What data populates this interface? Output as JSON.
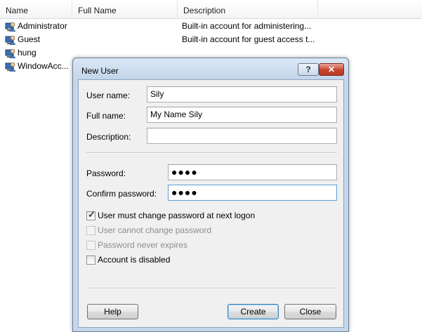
{
  "listview": {
    "columns": {
      "name": "Name",
      "full_name": "Full Name",
      "description": "Description"
    },
    "rows": [
      {
        "name": "Administrator",
        "full_name": "",
        "description": "Built-in account for administering..."
      },
      {
        "name": "Guest",
        "full_name": "",
        "description": "Built-in account for guest access t..."
      },
      {
        "name": "hung",
        "full_name": "",
        "description": ""
      },
      {
        "name": "WindowAcc...",
        "full_name": "",
        "description": ""
      }
    ]
  },
  "dialog": {
    "title": "New User",
    "help_glyph": "?",
    "close_glyph": "✕",
    "fields": {
      "user_name": {
        "label": "User name:",
        "value": "Sily"
      },
      "full_name": {
        "label": "Full name:",
        "value": "My Name Sily"
      },
      "description": {
        "label": "Description:",
        "value": ""
      },
      "password": {
        "label": "Password:",
        "value": "●●●●"
      },
      "confirm_password": {
        "label": "Confirm password:",
        "value": "●●●●"
      }
    },
    "options": [
      {
        "label": "User must change password at next logon",
        "checked": true,
        "enabled": true
      },
      {
        "label": "User cannot change password",
        "checked": false,
        "enabled": false
      },
      {
        "label": "Password never expires",
        "checked": false,
        "enabled": false
      },
      {
        "label": "Account is disabled",
        "checked": false,
        "enabled": true
      }
    ],
    "check_glyph": "✓",
    "buttons": {
      "help": "Help",
      "create": "Create",
      "close": "Close"
    }
  }
}
